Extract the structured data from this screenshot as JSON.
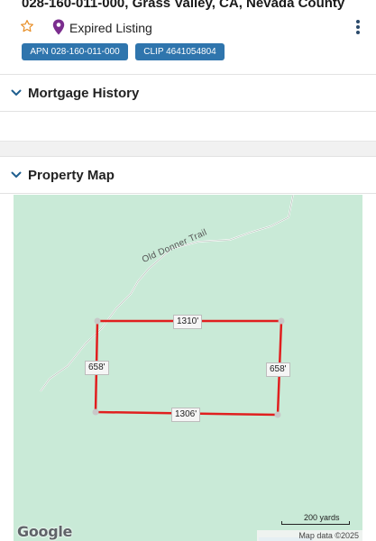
{
  "header": {
    "title": "028-160-011-000, Grass Valley, CA, Nevada County",
    "status": "Expired Listing",
    "badges": {
      "apn": "APN 028-160-011-000",
      "clip": "CLIP 4641054804"
    },
    "icons": [
      "star-icon",
      "map-pin-icon",
      "more-vertical-icon"
    ]
  },
  "sections": {
    "mortgage": {
      "label": "Mortgage History"
    },
    "property_map": {
      "label": "Property Map"
    }
  },
  "map": {
    "road_name": "Old Donner Trail",
    "edges": {
      "top": "1310'",
      "bottom": "1306'",
      "left": "658'",
      "right": "658'"
    },
    "scale_label": "200 yards",
    "attribution": "Map data ©2025",
    "logo": "Google",
    "colors": {
      "land": "#c9ead7",
      "boundary": "#e01f1f",
      "badge": "#2f75ad",
      "pin": "#7b2d8e",
      "star": "#e8902a"
    }
  }
}
